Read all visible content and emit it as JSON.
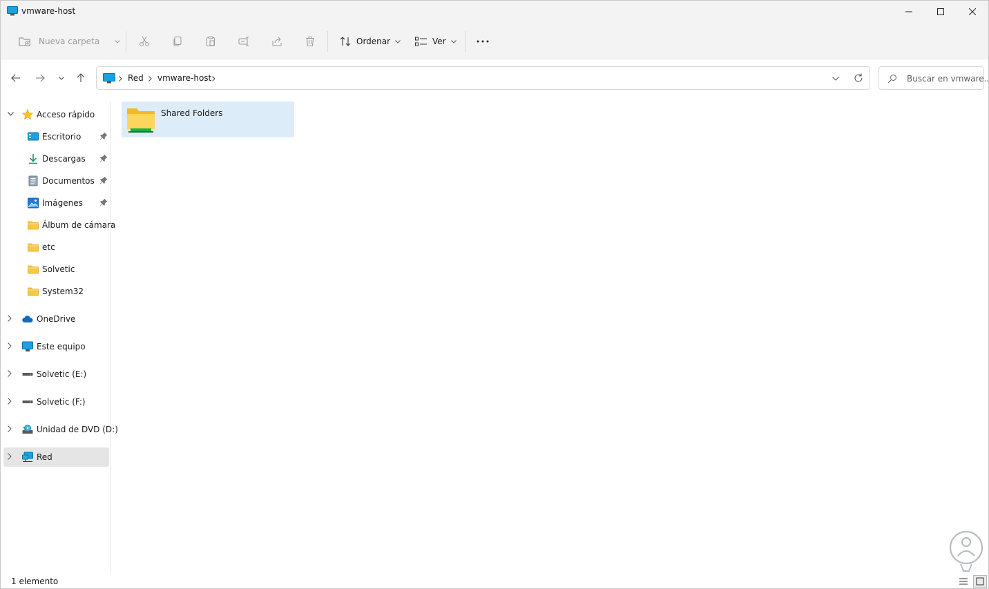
{
  "window": {
    "title": "vmware-host",
    "controls": [
      "minimize",
      "maximize",
      "close"
    ]
  },
  "commandbar": {
    "new_folder": "Nueva carpeta",
    "sort": "Ordenar",
    "view": "Ver",
    "disabled_actions": [
      "cut-icon",
      "copy-icon",
      "paste-icon",
      "rename-icon",
      "share-icon",
      "delete-icon"
    ]
  },
  "address": {
    "crumbs": [
      "Red",
      "vmware-host"
    ]
  },
  "search": {
    "placeholder": "Buscar en vmware..."
  },
  "sidebar": {
    "quick_access": "Acceso rápido",
    "pinned": [
      {
        "label": "Escritorio",
        "icon": "desktop-icon",
        "pinned": true
      },
      {
        "label": "Descargas",
        "icon": "download-icon",
        "pinned": true
      },
      {
        "label": "Documentos",
        "icon": "document-icon",
        "pinned": true
      },
      {
        "label": "Imágenes",
        "icon": "pictures-icon",
        "pinned": true
      },
      {
        "label": "Álbum de cámara",
        "icon": "folder-icon",
        "pinned": false
      },
      {
        "label": "etc",
        "icon": "folder-icon",
        "pinned": false
      },
      {
        "label": "Solvetic",
        "icon": "folder-icon",
        "pinned": false
      },
      {
        "label": "System32",
        "icon": "folder-icon",
        "pinned": false
      }
    ],
    "roots": [
      {
        "label": "OneDrive",
        "icon": "cloud-icon"
      },
      {
        "label": "Este equipo",
        "icon": "computer-icon"
      },
      {
        "label": "Solvetic (E:)",
        "icon": "drive-icon"
      },
      {
        "label": "Solvetic (F:)",
        "icon": "drive-icon"
      },
      {
        "label": "Unidad de DVD (D:)",
        "icon": "dvd-icon"
      },
      {
        "label": "Red",
        "icon": "network-icon",
        "selected": true
      }
    ]
  },
  "content": {
    "items": [
      {
        "label": "Shared Folders",
        "icon": "shared-folder-icon"
      }
    ]
  },
  "status": {
    "count": "1 elemento"
  },
  "colors": {
    "accent": "#0067c0",
    "selection": "#dcecf9",
    "folder": "#f8c845",
    "chrome": "#f3f3f3"
  }
}
